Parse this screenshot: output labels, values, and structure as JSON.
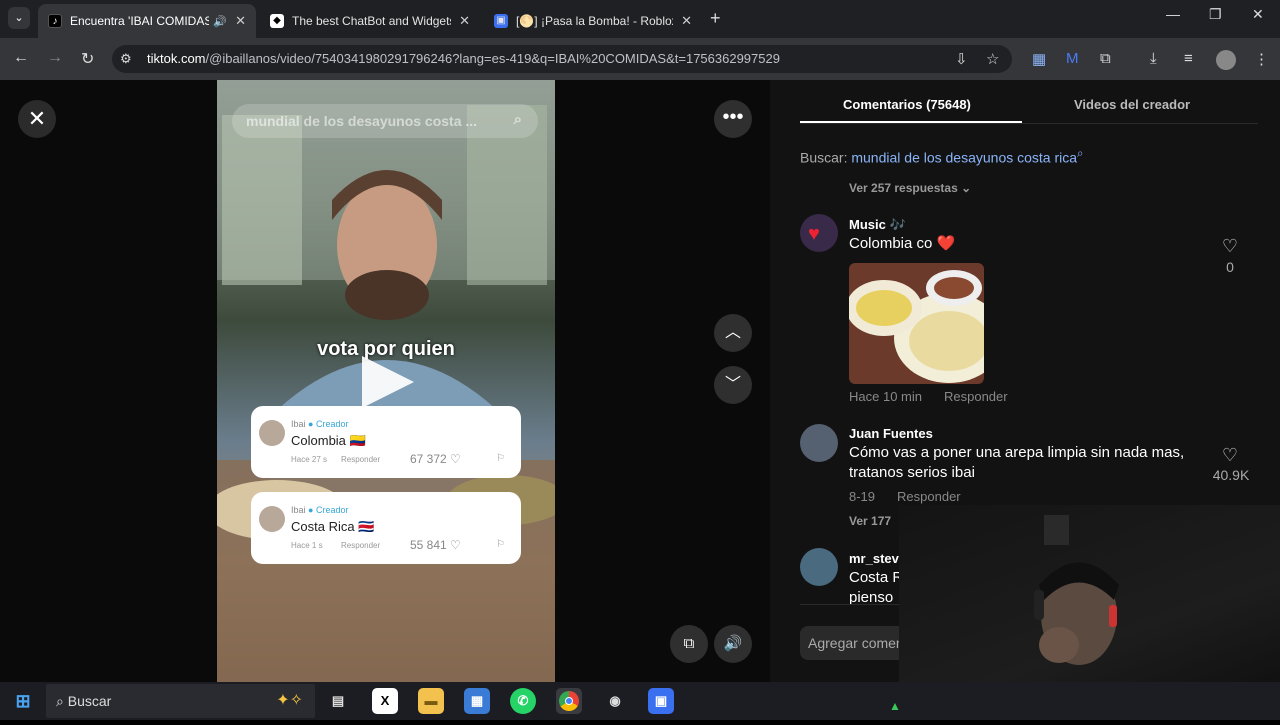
{
  "tabs": [
    {
      "title": "Encuentra 'IBAI COMIDAS'",
      "icon": "tiktok-icon",
      "active": true
    },
    {
      "title": "The best ChatBot and Widgets",
      "icon": "chatbot-icon",
      "active": false
    },
    {
      "title": "[🌕] ¡Pasa la Bomba! - Roblox",
      "icon": "roblox-icon",
      "active": false
    }
  ],
  "address": {
    "host": "tiktok.com",
    "path": "/@ibaillanos/video/7540341980291796246?lang=es-419&q=IBAI%20COMIDAS&t=1756362997529"
  },
  "video": {
    "search_overlay": "mundial de los desayunos costa ...",
    "caption": "vota por quien",
    "cards": [
      {
        "name": "Ibai",
        "badge": "Creador",
        "text": "Colombia 🇨🇴",
        "time": "Hace 27 s",
        "reply": "Responder",
        "likes": "67 372"
      },
      {
        "name": "Ibai",
        "badge": "Creador",
        "text": "Costa Rica 🇨🇷",
        "time": "Hace 1 s",
        "reply": "Responder",
        "likes": "55 841"
      }
    ]
  },
  "panel": {
    "tab_comments": "Comentarios (75648)",
    "tab_videos": "Videos del creador",
    "search_label": "Buscar:",
    "search_query": "mundial de los desayunos costa rica",
    "see_replies_top": "Ver 257 respuestas",
    "comments": [
      {
        "user": "Music 🎶",
        "text": "Colombia co ❤️",
        "time": "Hace 10 min",
        "reply": "Responder",
        "likes": "0"
      },
      {
        "user": "Juan Fuentes",
        "text": "Cómo vas a poner una arepa limpia sin nada mas, tratanos serios ibai",
        "time": "8-19",
        "reply": "Responder",
        "likes": "40.9K",
        "see_replies": "Ver 177"
      },
      {
        "user": "mr_steve",
        "text": "Costa R",
        "text2": "pienso"
      }
    ],
    "add_comment": "Agregar comen"
  },
  "taskbar": {
    "search": "Buscar"
  }
}
